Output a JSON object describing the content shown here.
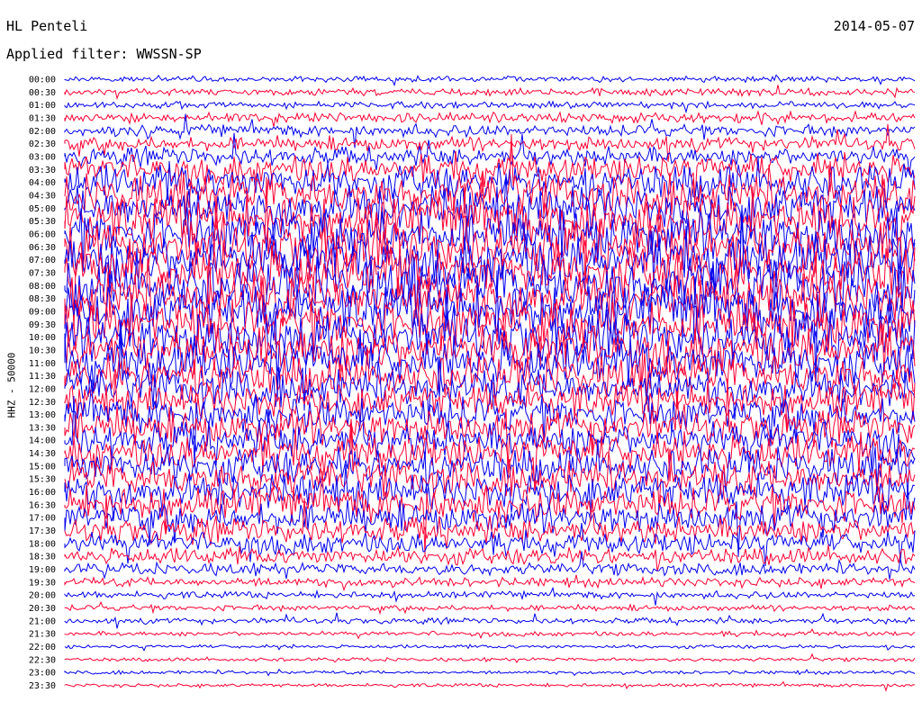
{
  "header": {
    "station": "HL Penteli",
    "date": "2014-05-07",
    "filter": "Applied filter: WWSSN-SP"
  },
  "channel_label": "HHZ - 50000",
  "colors": {
    "trace_odd": "#0000ee",
    "trace_even": "#ff0033",
    "text": "#000000"
  },
  "chart_data": {
    "type": "line",
    "title": "HL Penteli",
    "subtitle": "Applied filter: WWSSN-SP",
    "ylabel": "HHZ - 50000",
    "xlabel": "",
    "row_labels": [
      "00:00",
      "00:30",
      "01:00",
      "01:30",
      "02:00",
      "02:30",
      "03:00",
      "03:30",
      "04:00",
      "04:30",
      "05:00",
      "05:30",
      "06:00",
      "06:30",
      "07:00",
      "07:30",
      "08:00",
      "08:30",
      "09:00",
      "09:30",
      "10:00",
      "10:30",
      "11:00",
      "11:30",
      "12:00",
      "12:30",
      "13:00",
      "13:30",
      "14:00",
      "14:30",
      "15:00",
      "15:30",
      "16:00",
      "16:30",
      "17:00",
      "17:30",
      "18:00",
      "18:30",
      "19:00",
      "19:30",
      "20:00",
      "20:30",
      "21:00",
      "21:30",
      "22:00",
      "22:30",
      "23:00",
      "23:30"
    ],
    "row_duration_minutes": 30,
    "relative_activity": [
      0.5,
      0.6,
      0.6,
      0.8,
      1,
      1.2,
      1.6,
      2.4,
      3,
      3.4,
      3.8,
      4,
      4.2,
      4.3,
      4.4,
      4.5,
      4.5,
      4.4,
      4.3,
      4.2,
      4.1,
      4,
      3.8,
      3.5,
      3.2,
      3,
      3,
      3,
      3,
      3,
      3,
      3,
      3,
      2.9,
      2.6,
      2.2,
      1.8,
      1.4,
      1,
      0.8,
      0.6,
      0.5,
      0.5,
      0.4,
      0.3,
      0.3,
      0.3,
      0.3
    ],
    "grid": false
  }
}
